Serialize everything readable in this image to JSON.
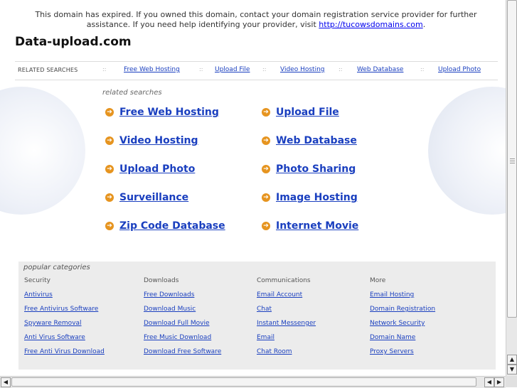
{
  "notice": {
    "text_before": "This domain has expired. If you owned this domain, contact your domain registration service provider for further assistance. If you need help identifying your provider, visit",
    "link_text": "http://tucowsdomains.com",
    "text_after": "."
  },
  "site_title": "Data-upload.com",
  "related_bar": {
    "label": "RELATED SEARCHES",
    "separator": "::",
    "links": [
      "Free Web Hosting",
      "Upload File",
      "Video Hosting",
      "Web Database",
      "Upload Photo"
    ]
  },
  "related_searches": {
    "heading": "related searches",
    "bullet_icon": "arrow-right-circle-icon",
    "bullet_color": "#e6941f",
    "links": [
      "Free Web Hosting",
      "Upload File",
      "Video Hosting",
      "Web Database",
      "Upload Photo",
      "Photo Sharing",
      "Surveillance",
      "Image Hosting",
      "Zip Code Database",
      "Internet Movie"
    ]
  },
  "popular_categories": {
    "heading": "popular categories",
    "columns": [
      {
        "title": "Security",
        "links": [
          "Antivirus",
          "Free Antivirus Software",
          "Spyware Removal",
          "Anti Virus Software",
          "Free Anti Virus Download"
        ]
      },
      {
        "title": "Downloads",
        "links": [
          "Free Downloads",
          "Download Music",
          "Download Full Movie",
          "Free Music Download",
          "Download Free Software"
        ]
      },
      {
        "title": "Communications",
        "links": [
          "Email Account",
          "Chat",
          "Instant Messenger",
          "Email",
          "Chat Room"
        ]
      },
      {
        "title": "More",
        "links": [
          "Email Hosting",
          "Domain Registration",
          "Network Security",
          "Domain Name",
          "Proxy Servers"
        ]
      }
    ]
  },
  "scrollbar": {
    "up_icon": "triangle-up-icon",
    "down_icon": "triangle-down-icon",
    "left_icon": "triangle-left-icon",
    "right_icon": "triangle-right-icon"
  },
  "colors": {
    "link": "#1a3fbf",
    "popular_bg": "#ececec"
  }
}
